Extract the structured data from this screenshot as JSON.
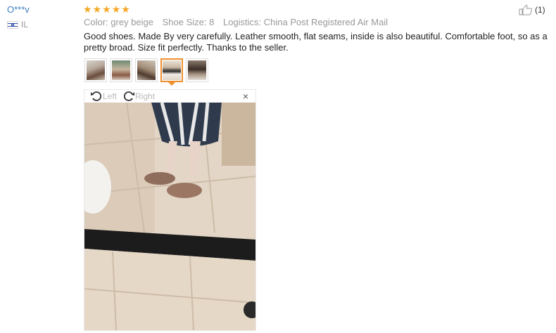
{
  "reviewer": {
    "name": "O***v",
    "country": "IL"
  },
  "rating": {
    "stars": 5,
    "color": "#f5a623"
  },
  "attributes": [
    "Color: grey beige",
    "Shoe Size: 8",
    "Logistics: China Post Registered Air Mail"
  ],
  "review_text": "Good shoes. Made By very carefully. Leather smooth, flat seams, inside is also beautiful. Comfortable foot, so as a pretty broad. Size fit perfectly. Thanks to the seller.",
  "helpful": {
    "icon": "thumbs-up-icon",
    "count": "(1)"
  },
  "thumbnails": {
    "count": 5,
    "active_index": 3
  },
  "viewer": {
    "rotate_left_label": "Left",
    "rotate_right_label": "Right",
    "close_icon": "close-icon",
    "close_glyph": "×"
  },
  "colors": {
    "link": "#3b7ec2",
    "active_border": "#f08f2e"
  }
}
